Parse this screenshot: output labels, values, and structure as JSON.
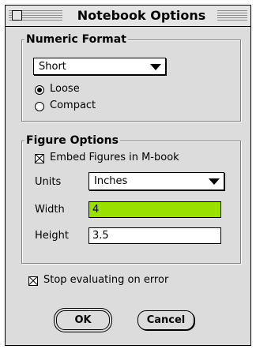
{
  "window": {
    "title": "Notebook Options"
  },
  "numeric_format": {
    "group_label": "Numeric Format",
    "format_selected": "Short",
    "spacing_options": [
      {
        "label": "Loose",
        "selected": true
      },
      {
        "label": "Compact",
        "selected": false
      }
    ]
  },
  "figure_options": {
    "group_label": "Figure Options",
    "embed_label": "Embed Figures in M-book",
    "embed_checked": true,
    "units_label": "Units",
    "units_value": "Inches",
    "width_label": "Width",
    "width_value": "4",
    "height_label": "Height",
    "height_value": "3.5"
  },
  "stop_on_error": {
    "label": "Stop evaluating on error",
    "checked": true
  },
  "buttons": {
    "ok": "OK",
    "cancel": "Cancel"
  },
  "colors": {
    "active_field": "#99e000",
    "dialog_bg": "#dcdcdc"
  }
}
